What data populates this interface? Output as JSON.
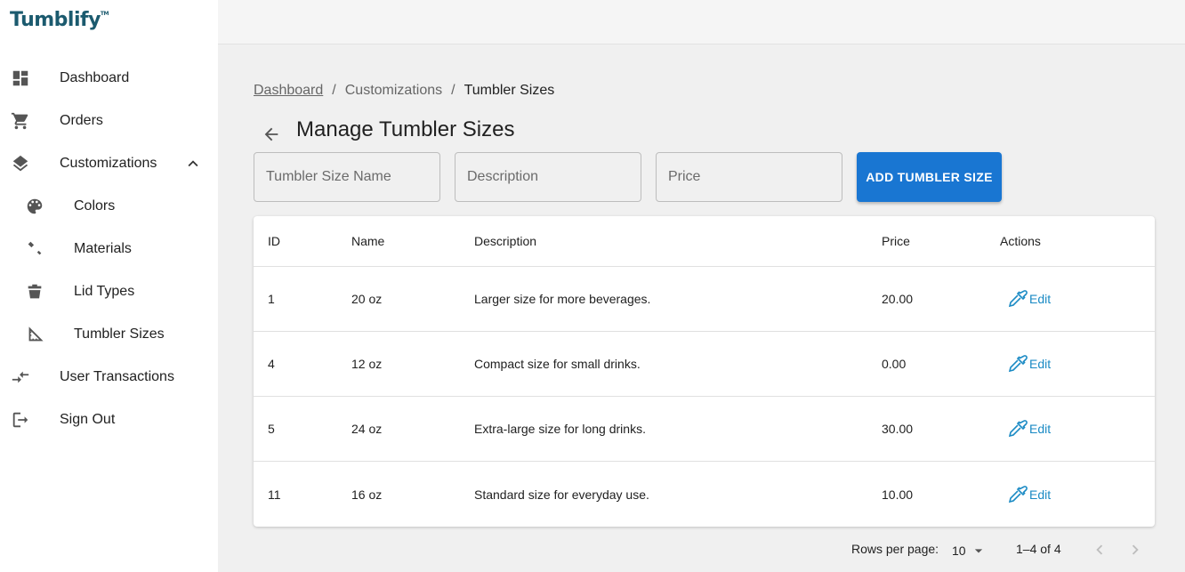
{
  "app": {
    "logo": "Tumblify",
    "logo_mark": "TM"
  },
  "sidebar": {
    "items": [
      {
        "label": "Dashboard",
        "icon": "dashboard-icon"
      },
      {
        "label": "Orders",
        "icon": "cart-icon"
      },
      {
        "label": "Customizations",
        "icon": "layers-icon",
        "expanded": true
      },
      {
        "label": "Colors",
        "icon": "palette-icon"
      },
      {
        "label": "Materials",
        "icon": "brush-icon"
      },
      {
        "label": "Lid Types",
        "icon": "lid-icon"
      },
      {
        "label": "Tumbler Sizes",
        "icon": "ruler-icon"
      },
      {
        "label": "User Transactions",
        "icon": "compare-arrows-icon"
      },
      {
        "label": "Sign Out",
        "icon": "logout-icon"
      }
    ]
  },
  "breadcrumb": {
    "items": [
      "Dashboard",
      "Customizations"
    ],
    "current": "Tumbler Sizes",
    "separator": "/"
  },
  "header": {
    "title": "Manage Tumbler Sizes"
  },
  "form": {
    "name_placeholder": "Tumbler Size Name",
    "desc_placeholder": "Description",
    "price_placeholder": "Price",
    "add_label": "ADD TUMBLER SIZE"
  },
  "table": {
    "headers": {
      "id": "ID",
      "name": "Name",
      "description": "Description",
      "price": "Price",
      "actions": "Actions"
    },
    "edit_label": "Edit",
    "rows": [
      {
        "id": "1",
        "name": "20 oz",
        "description": "Larger size for more beverages.",
        "price": "20.00"
      },
      {
        "id": "4",
        "name": "12 oz",
        "description": "Compact size for small drinks.",
        "price": "0.00"
      },
      {
        "id": "5",
        "name": "24 oz",
        "description": "Extra-large size for long drinks.",
        "price": "30.00"
      },
      {
        "id": "11",
        "name": "16 oz",
        "description": "Standard size for everyday use.",
        "price": "10.00"
      }
    ]
  },
  "pagination": {
    "rows_label": "Rows per page:",
    "rows_value": "10",
    "range": "1–4 of 4"
  },
  "colors": {
    "accent": "#1976d2",
    "edit": "#1a8ac4",
    "logo": "#1b5a6e"
  }
}
